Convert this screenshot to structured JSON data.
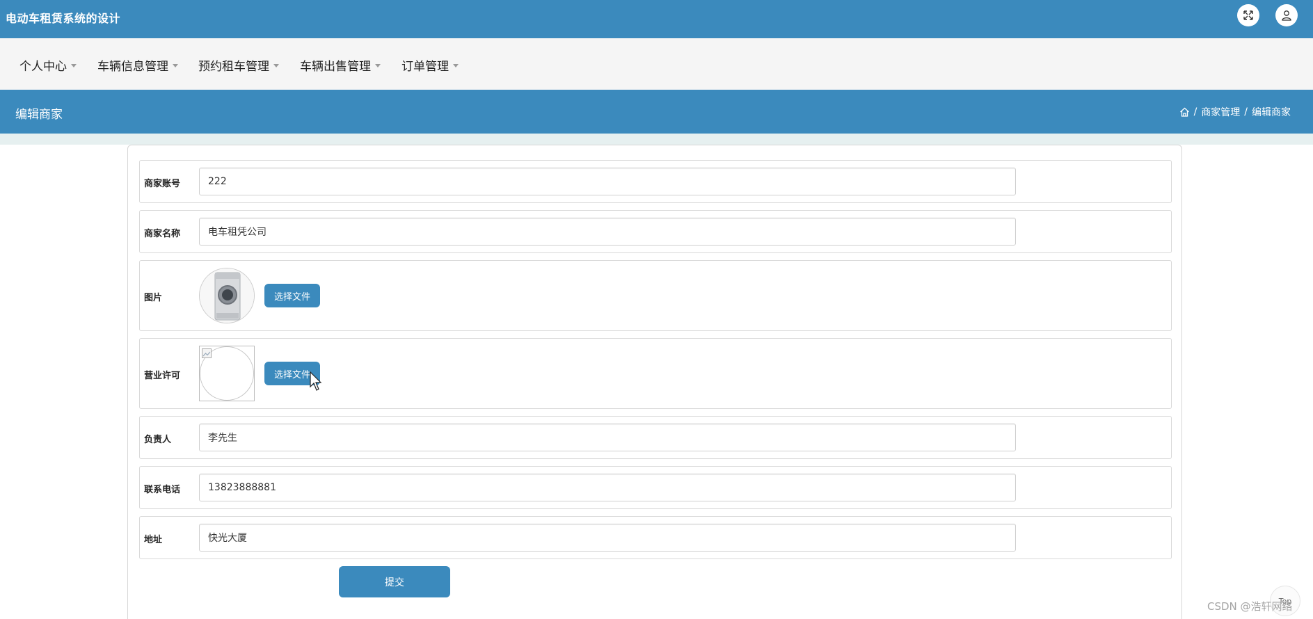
{
  "app": {
    "title": "电动车租赁系统的设计"
  },
  "nav": {
    "items": [
      {
        "label": "个人中心"
      },
      {
        "label": "车辆信息管理"
      },
      {
        "label": "预约租车管理"
      },
      {
        "label": "车辆出售管理"
      },
      {
        "label": "订单管理"
      }
    ]
  },
  "header": {
    "page_title": "编辑商家",
    "breadcrumb": [
      "商家管理",
      "编辑商家"
    ],
    "separator": "/"
  },
  "form": {
    "account_label": "商家账号",
    "account_value": "222",
    "name_label": "商家名称",
    "name_value": "电车租凭公司",
    "image_label": "图片",
    "license_label": "营业许可",
    "choose_file": "选择文件",
    "manager_label": "负责人",
    "manager_value": "李先生",
    "phone_label": "联系电话",
    "phone_value": "13823888881",
    "address_label": "地址",
    "address_value": "快光大厦",
    "submit": "提交"
  },
  "footer": {
    "top_label": "Top",
    "watermark": "CSDN @浩轩网络"
  },
  "colors": {
    "primary": "#3b8abd",
    "nav_bg": "#f5f5f5",
    "sub_band": "#e6f0f0"
  },
  "icons": {
    "fullscreen": "expand-icon",
    "user": "user-icon",
    "home": "home-icon"
  }
}
